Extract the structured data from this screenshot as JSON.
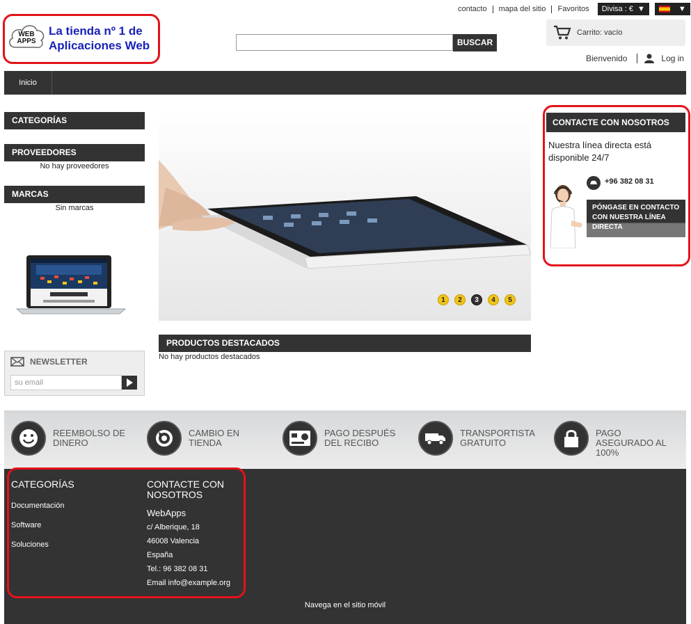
{
  "header": {
    "links": [
      "contacto",
      "mapa del sitio",
      "Favoritos"
    ],
    "currency_label": "Divisa : €",
    "logo": {
      "badge_line1": "WEB",
      "badge_line2": "APPS",
      "line1": "La tienda nº 1 de",
      "line2": "Aplicaciones Web"
    },
    "search": {
      "value": "",
      "placeholder": "",
      "button_label": "BUSCAR"
    },
    "cart_label": "Carrito: vacío",
    "welcome_label": "Bienvenido",
    "login_label": "Log in"
  },
  "nav": {
    "items": [
      "Inicio"
    ]
  },
  "sidebar": {
    "categories_title": "CATEGORÍAS",
    "suppliers_title": "PROVEEDORES",
    "suppliers_empty": "No hay proveedores",
    "brands_title": "MARCAS",
    "brands_empty": "Sin marcas",
    "newsletter": {
      "title": "NEWSLETTER",
      "placeholder": "su email"
    }
  },
  "slider": {
    "pages": [
      "1",
      "2",
      "3",
      "4",
      "5"
    ],
    "active_page": "3"
  },
  "featured": {
    "title": "PRODUCTOS DESTACADOS",
    "empty": "No hay productos destacados"
  },
  "contact_block": {
    "title": "CONTACTE CON NOSOTROS",
    "text": "Nuestra línea directa está disponible 24/7",
    "phone": "+96 382 08 31",
    "button_line1": "PÓNGASE EN CONTACTO",
    "button_line2": "CON NUESTRA LÍNEA",
    "button_line3": "DIRECTA"
  },
  "reassurance": [
    {
      "line1": "Reembolso de",
      "line2": "dinero",
      "line3": "",
      "icon": "smiley-icon"
    },
    {
      "line1": "Cambio en",
      "line2": "tienda",
      "line3": "",
      "icon": "refresh-icon"
    },
    {
      "line1": "Pago después",
      "line2": "del recibo",
      "line3": "",
      "icon": "card-icon"
    },
    {
      "line1": "Transportista",
      "line2": "gratuito",
      "line3": "",
      "icon": "truck-icon"
    },
    {
      "line1": "Pago",
      "line2": "asegurado al",
      "line3": "100%",
      "icon": "lock-icon"
    }
  ],
  "footer": {
    "categories_title": "CATEGORÍAS",
    "categories": [
      "Documentación",
      "Software",
      "Soluciones"
    ],
    "contact_title_line1": "CONTACTE CON",
    "contact_title_line2": "NOSOTROS",
    "company": "WebApps",
    "address": "c/ Alberique, 18",
    "city": "46008 Valencia",
    "country": "España",
    "phone": "Tel.: 96 382 08 31",
    "email": "Email info@example.org",
    "mobile_link": "Navega en el sitio móvil"
  },
  "colors": {
    "dark": "#333333",
    "highlight": "#e3121b",
    "logo_blue": "#1a22b8",
    "slider_dot": "#f0c419"
  }
}
